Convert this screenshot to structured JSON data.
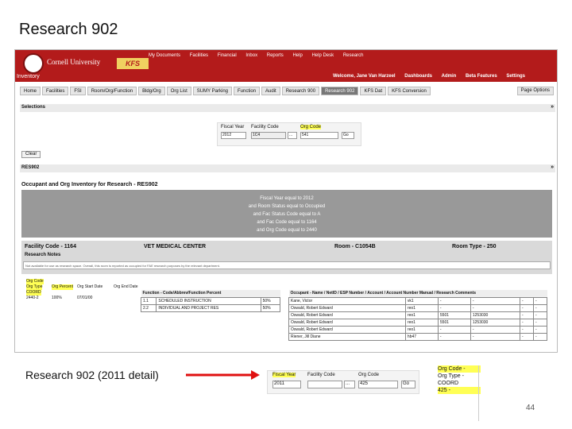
{
  "slide": {
    "title": "Research 902",
    "caption": "Research 902 (2011 detail)",
    "page_number": "44"
  },
  "app": {
    "brand": "Cornell University",
    "product": "KFS",
    "top_links": [
      "My Documents",
      "Facilities",
      "Financial",
      "Inbox",
      "Reports",
      "Help",
      "Help Desk",
      "Research"
    ],
    "module": "Inventory",
    "welcome": "Welcome, Jane Van Harzeel",
    "nav_links": [
      "Dashboards",
      "Admin",
      "Beta Features",
      "Settings"
    ],
    "tabs": [
      "Home",
      "Facilities",
      "FSI",
      "Room/Org/Function",
      "Bldg/Org",
      "Org List",
      "SUMY Parking",
      "Function",
      "Audit",
      "Research 900",
      "Research 902",
      "KFS Dat",
      "KFS Conversion"
    ],
    "page_options": "Page Options",
    "selections": {
      "header": "Selections",
      "fiscal_year_label": "Fiscal Year",
      "facility_code_label": "Facility Code",
      "org_code_label": "Org Code",
      "fiscal_year_value": "2012",
      "facility_code_value": "1C4",
      "org_code_value": "541",
      "ellipsis": "...",
      "go": "Go",
      "clear": "Clear"
    },
    "report": {
      "panel": "RES902",
      "title": "Occupant and Org Inventory for Research - RES902",
      "criteria": [
        "Fiscal Year equal to 2012",
        "and Room Status equal to Occupied",
        "and Fac Status Code equal to A",
        "and Fac Code equal to 1164",
        "and Org Code equal to 2440"
      ],
      "facility_code": "Facility Code - 1164",
      "facility_name": "VET MEDICAL CENTER",
      "room": "Room - C1054B",
      "room_type": "Room Type - 250",
      "research_notes": "Research Notes",
      "notes_text": "Not available for use as research space. Overall, this room is reported as occupied for FAE research purposes by the relevant department."
    },
    "org_info": {
      "headers": [
        "Org Code",
        "Org Type",
        "Org Percent",
        "Org Start Date",
        "Org End Date"
      ],
      "values": [
        "2440-2",
        "100%",
        "07/01/00",
        "COORD"
      ],
      "highlight": "COORD"
    },
    "function_table": {
      "header": "Function - Code/Abbrev/Function Percent",
      "rows": [
        [
          "1.1",
          "SCHEDULED INSTRUCTION",
          "50%"
        ],
        [
          "2.2",
          "INDIVIDUAL AND PROJECT RES",
          "50%"
        ]
      ]
    },
    "occupant_table": {
      "headers": [
        "Occupant - Name / NetID / ESP Number / Account / Account Number Manual / Research Comments"
      ],
      "rows": [
        [
          "Kane, Victor",
          "vk1",
          "-",
          "-",
          "-",
          "-"
        ],
        [
          "Oswald, Robert Edward",
          "reo1",
          "-",
          "-",
          "-",
          "-"
        ],
        [
          "Oswald, Robert Edward",
          "reo1",
          "5501",
          "1253030",
          "-",
          "-"
        ],
        [
          "Oswald, Robert Edward",
          "reo1",
          "5501",
          "1253030",
          "-",
          "-"
        ],
        [
          "Oswald, Robert Edward",
          "reo1",
          "-",
          "-",
          "-",
          "-"
        ],
        [
          "Riener, Jill Diane",
          "hb47",
          "-",
          "-",
          "-",
          "-"
        ]
      ]
    }
  },
  "detail": {
    "fiscal_year_label": "Fiscal Year",
    "facility_code_label": "Facility Code",
    "org_code_label": "Org Code",
    "fiscal_year_value": "2011",
    "facility_code_value": "",
    "org_code_value": "425",
    "ellipsis": "...",
    "go": "Go",
    "org_code_row": "Org Code -",
    "org_type_row": "Org Type -",
    "coord_row": "COORD",
    "value_row": "425 -"
  },
  "colors": {
    "header_red": "#b31b1b",
    "highlight": "#ffff55",
    "arrow": "#e01010"
  }
}
